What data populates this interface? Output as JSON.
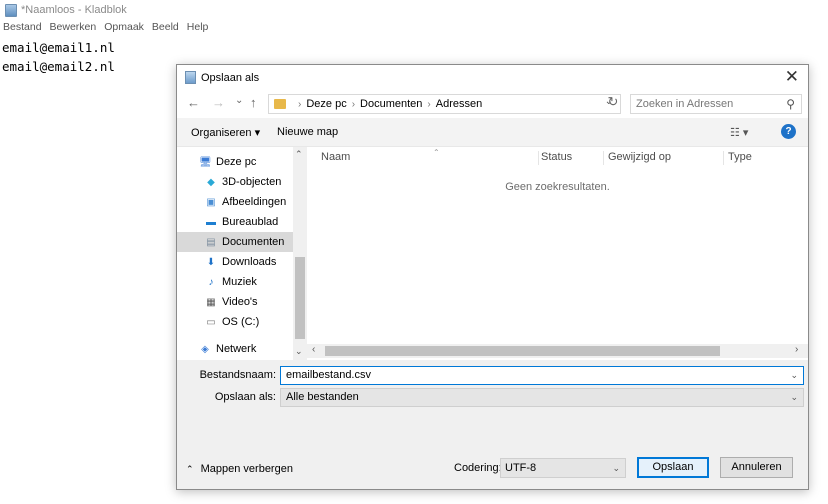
{
  "notepad": {
    "title": "*Naamloos - Kladblok",
    "menu": [
      "Bestand",
      "Bewerken",
      "Opmaak",
      "Beeld",
      "Help"
    ],
    "lines": [
      "email@email1.nl",
      "email@email2.nl"
    ]
  },
  "dialog": {
    "title": "Opslaan als",
    "close": "✕",
    "nav": {
      "back": "←",
      "forward": "→",
      "recent": "⌄",
      "up": "↑"
    },
    "breadcrumb": [
      "Deze pc",
      "Documenten",
      "Adressen"
    ],
    "search_placeholder": "Zoeken in Adressen",
    "toolbar": {
      "organize": "Organiseren ▾",
      "new_folder": "Nieuwe map",
      "help": "?"
    },
    "tree": [
      {
        "label": "Deze pc",
        "icon": "computer-icon",
        "glyph": "🖥",
        "color": "#3a7bd5"
      },
      {
        "label": "3D-objecten",
        "icon": "cube-icon",
        "glyph": "◆",
        "color": "#2aa9d6"
      },
      {
        "label": "Afbeeldingen",
        "icon": "pictures-icon",
        "glyph": "▣",
        "color": "#4a8ed4"
      },
      {
        "label": "Bureaublad",
        "icon": "desktop-icon",
        "glyph": "▬",
        "color": "#1e7fd1"
      },
      {
        "label": "Documenten",
        "icon": "documents-icon",
        "glyph": "▤",
        "color": "#7a8b9c",
        "selected": true
      },
      {
        "label": "Downloads",
        "icon": "download-icon",
        "glyph": "⬇",
        "color": "#1e72c8"
      },
      {
        "label": "Muziek",
        "icon": "music-icon",
        "glyph": "♪",
        "color": "#1e72c8"
      },
      {
        "label": "Video's",
        "icon": "video-icon",
        "glyph": "▦",
        "color": "#555555"
      },
      {
        "label": "OS (C:)",
        "icon": "drive-icon",
        "glyph": "▭",
        "color": "#777777"
      },
      {
        "label": "Netwerk",
        "icon": "network-icon",
        "glyph": "◈",
        "color": "#3a7bd5"
      }
    ],
    "columns": [
      "Naam",
      "Status",
      "Gewijzigd op",
      "Type"
    ],
    "empty_message": "Geen zoekresultaten.",
    "filename_label": "Bestandsnaam:",
    "filename_value": "emailbestand.csv",
    "savetype_label": "Opslaan als:",
    "savetype_value": "Alle bestanden",
    "hide_folders": "Mappen verbergen",
    "encoding_label": "Codering:",
    "encoding_value": "UTF-8",
    "save_button": "Opslaan",
    "cancel_button": "Annuleren"
  }
}
